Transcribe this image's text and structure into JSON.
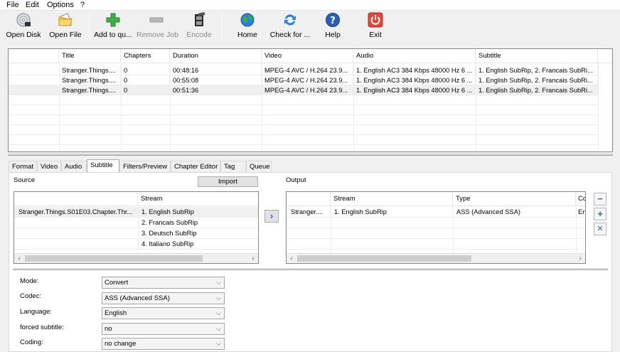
{
  "menu": [
    "File",
    "Edit",
    "Options",
    "?"
  ],
  "toolbar": {
    "open_disk": "Open Disk",
    "open_file": "Open File",
    "add_queue": "Add to qu...",
    "remove_job": "Remove Job",
    "encode": "Encode",
    "home": "Home",
    "check": "Check for ...",
    "help": "Help",
    "exit": "Exit"
  },
  "titles_table": {
    "headers": [
      "Title",
      "Chapters",
      "Duration",
      "Video",
      "Audio",
      "Subtitle"
    ],
    "rows": [
      [
        "Stranger.Things....",
        "0",
        "00:48:16",
        "MPEG-4 AVC / H.264 23.9...",
        "1. English AC3 384 Kbps 48000 Hz 6 ...",
        "1. English SubRip, 2. Francais SubRi..."
      ],
      [
        "Stranger.Things....",
        "0",
        "00:55:08",
        "MPEG-4 AVC / H.264 23.9...",
        "1. English AC3 384 Kbps 48000 Hz 6 ...",
        "1. English SubRip, 2. Francais SubRi..."
      ],
      [
        "Stranger.Things....",
        "0",
        "00:51:36",
        "MPEG-4 AVC / H.264 23.9...",
        "1. English AC3 384 Kbps 48000 Hz 6 ...",
        "1. English SubRip, 2. Francais SubRi..."
      ]
    ]
  },
  "tabs": [
    "Format",
    "Video",
    "Audio",
    "Subtitle",
    "Filters/Preview",
    "Chapter Editor",
    "Tag",
    "Queue"
  ],
  "source": {
    "label": "Source",
    "import_label": "Import",
    "stream_header": "Stream",
    "file": "Stranger.Things.S01E03.Chapter.Thr...",
    "streams": [
      "1. English SubRip",
      "2. Francais SubRip",
      "3. Deutsch SubRip",
      "4. Italiano SubRip"
    ]
  },
  "output": {
    "label": "Output",
    "headers": [
      "Stream",
      "Type",
      "Co"
    ],
    "row": [
      "Stranger....",
      "1. English SubRip",
      "ASS (Advanced SSA)",
      "En"
    ]
  },
  "form": [
    {
      "label": "Mode:",
      "value": "Convert"
    },
    {
      "label": "Codec:",
      "value": "ASS (Advanced SSA)"
    },
    {
      "label": "Language:",
      "value": "English"
    },
    {
      "label": "forced subtitle:",
      "value": "no"
    },
    {
      "label": "Coding:",
      "value": "no change"
    }
  ],
  "glyphs": {
    "arrow_right": "›",
    "arrow_left": "‹",
    "combo_arrow": "⌵",
    "minus": "−",
    "plus": "+",
    "close": "✕",
    "move": "›"
  }
}
